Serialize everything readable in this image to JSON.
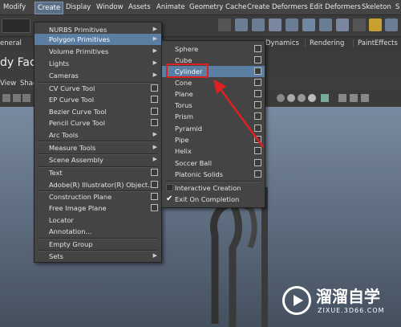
{
  "menubar": {
    "items": [
      "Modify",
      "Create",
      "Display",
      "Window",
      "Assets",
      "Animate",
      "Geometry Cache",
      "Create Deformers",
      "Edit Deformers",
      "Skeleton",
      "S"
    ]
  },
  "shelf_tabs": [
    "eneral",
    "Dynamics",
    "Rendering",
    "PaintEffects"
  ],
  "shelf_label": "dy Face",
  "viewport_menu": [
    "View",
    "Shac"
  ],
  "create_menu": {
    "items": [
      {
        "label": "NURBS Primitives",
        "type": "sub"
      },
      {
        "label": "Polygon Primitives",
        "type": "sub",
        "highlight": true
      },
      {
        "label": "Volume Primitives",
        "type": "sub"
      },
      {
        "label": "Lights",
        "type": "sub"
      },
      {
        "label": "Cameras",
        "type": "sub"
      },
      {
        "label": "CV Curve Tool",
        "type": "box"
      },
      {
        "label": "EP Curve Tool",
        "type": "box"
      },
      {
        "label": "Bezier Curve Tool",
        "type": "box"
      },
      {
        "label": "Pencil Curve Tool",
        "type": "box"
      },
      {
        "label": "Arc Tools",
        "type": "sub"
      },
      {
        "label": "Measure Tools",
        "type": "sub"
      },
      {
        "label": "Scene Assembly",
        "type": "sub"
      },
      {
        "label": "Text",
        "type": "box"
      },
      {
        "label": "Adobe(R) Illustrator(R) Object...",
        "type": "box"
      },
      {
        "label": "Construction Plane",
        "type": "box"
      },
      {
        "label": "Free Image Plane",
        "type": "box"
      },
      {
        "label": "Locator",
        "type": "none"
      },
      {
        "label": "Annotation...",
        "type": "none"
      },
      {
        "label": "Empty Group",
        "type": "none"
      },
      {
        "label": "Sets",
        "type": "sub"
      }
    ]
  },
  "poly_menu": {
    "items": [
      {
        "label": "Sphere"
      },
      {
        "label": "Cube"
      },
      {
        "label": "Cylinder",
        "highlight": true
      },
      {
        "label": "Cone"
      },
      {
        "label": "Plane"
      },
      {
        "label": "Torus"
      },
      {
        "label": "Prism"
      },
      {
        "label": "Pyramid"
      },
      {
        "label": "Pipe"
      },
      {
        "label": "Helix"
      },
      {
        "label": "Soccer Ball"
      },
      {
        "label": "Platonic Solids"
      }
    ],
    "options": [
      {
        "label": "Interactive Creation",
        "checked": false
      },
      {
        "label": "Exit On Completion",
        "checked": true
      }
    ]
  },
  "watermark": {
    "title": "溜溜自学",
    "url": "ZIXUE.3D66.COM"
  },
  "colors": {
    "highlight": "#5b7ea3",
    "annotation": "#e02020"
  }
}
